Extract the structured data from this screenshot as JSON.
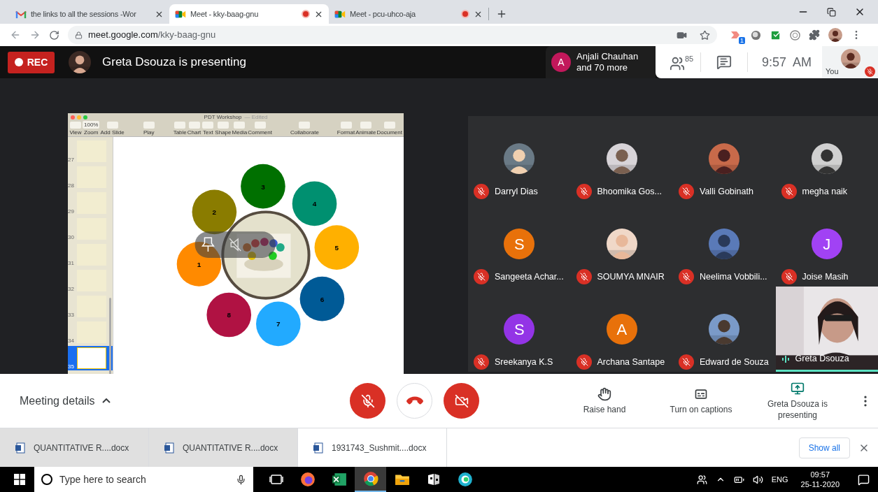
{
  "browser": {
    "tabs": [
      {
        "title": "the links to all the sessions -Wor",
        "kind": "mail",
        "selected": false,
        "recording": false
      },
      {
        "title": "Meet - kky-baag-gnu",
        "kind": "meet",
        "selected": true,
        "recording": true
      },
      {
        "title": "Meet - pcu-uhco-aja",
        "kind": "meet",
        "selected": false,
        "recording": true
      }
    ],
    "url_host": "meet.google.com",
    "url_path": "/kky-baag-gnu",
    "extension_badge": "1"
  },
  "meet": {
    "rec_label": "REC",
    "presenter_text": "Greta Dsouza is presenting",
    "notice": {
      "initial": "A",
      "name": "Anjali Chauhan",
      "more": "and 70 more"
    },
    "people_count": "85",
    "time": "9:57  AM",
    "self_label": "You",
    "self_muted": true
  },
  "presentation": {
    "app_title": "PDT Workshop",
    "app_status": "— Edited",
    "zoom": "100%",
    "toolbar_groups": [
      [
        {
          "label": "View"
        },
        {
          "label": "Zoom"
        },
        {
          "label": "Add Slide"
        }
      ],
      [
        {
          "label": "Play"
        }
      ],
      [
        {
          "label": "Table"
        },
        {
          "label": "Chart"
        },
        {
          "label": "Text"
        },
        {
          "label": "Shape"
        },
        {
          "label": "Media"
        },
        {
          "label": "Comment"
        }
      ],
      [
        {
          "label": "Collaborate"
        }
      ],
      [
        {
          "label": "Format"
        },
        {
          "label": "Animate"
        },
        {
          "label": "Document"
        }
      ]
    ],
    "slides": [
      {
        "number": "27",
        "selected": false
      },
      {
        "number": "28",
        "selected": false
      },
      {
        "number": "29",
        "selected": false
      },
      {
        "number": "30",
        "selected": false
      },
      {
        "number": "31",
        "selected": false
      },
      {
        "number": "32",
        "selected": false
      },
      {
        "number": "33",
        "selected": false
      },
      {
        "number": "34",
        "selected": false
      },
      {
        "number": "35",
        "selected": true
      }
    ],
    "circles": [
      {
        "label": "1",
        "color": "#ff8a00"
      },
      {
        "label": "2",
        "color": "#8a7c00"
      },
      {
        "label": "3",
        "color": "#007000"
      },
      {
        "label": "4",
        "color": "#009070"
      },
      {
        "label": "5",
        "color": "#ffb000"
      },
      {
        "label": "6",
        "color": "#005a96"
      },
      {
        "label": "7",
        "color": "#22aaff"
      },
      {
        "label": "8",
        "color": "#b01243"
      }
    ]
  },
  "participants": [
    {
      "name": "Darryl Dias",
      "muted": true
    },
    {
      "name": "Bhoomika Gos...",
      "muted": true
    },
    {
      "name": "Valli Gobinath",
      "muted": true
    },
    {
      "name": "megha naik",
      "muted": true
    },
    {
      "name": "Sangeeta Achar...",
      "kind": "letter",
      "initial": "S",
      "color": "#e8710a",
      "muted": true
    },
    {
      "name": "SOUMYA MNAIR",
      "muted": true
    },
    {
      "name": "Neelima Vobbili...",
      "muted": true
    },
    {
      "name": "Joise Masih",
      "kind": "letter",
      "initial": "J",
      "color": "#a142f4",
      "muted": true
    },
    {
      "name": "Sreekanya K.S",
      "kind": "letter",
      "initial": "S",
      "color": "#9334e6",
      "muted": true
    },
    {
      "name": "Archana Santape",
      "kind": "letter",
      "initial": "A",
      "color": "#e8710a",
      "muted": true
    },
    {
      "name": "Edward de Souza",
      "muted": true
    },
    {
      "name": "Greta Dsouza",
      "kind": "video",
      "muted": false
    }
  ],
  "controls": {
    "meeting_details": "Meeting details",
    "mic_muted": true,
    "camera_off": true,
    "actions": [
      {
        "kind": "hand",
        "label": "Raise hand"
      },
      {
        "kind": "captions",
        "label": "Turn on captions"
      },
      {
        "kind": "present",
        "label": "Greta Dsouza is presenting"
      }
    ]
  },
  "downloads": {
    "items": [
      {
        "name": "QUANTITATIVE R....docx",
        "highlighted": true
      },
      {
        "name": "QUANTITATIVE R....docx",
        "highlighted": true
      },
      {
        "name": "1931743_Sushmit....docx",
        "highlighted": false
      }
    ],
    "show_all": "Show all"
  },
  "taskbar": {
    "search_placeholder": "Type here to search",
    "apps": [
      {
        "kind": "taskview",
        "active": false
      },
      {
        "kind": "firefox",
        "active": false
      },
      {
        "kind": "excel",
        "active": false
      },
      {
        "kind": "chrome",
        "active": true
      },
      {
        "kind": "files",
        "active": false
      },
      {
        "kind": "store",
        "active": false
      },
      {
        "kind": "edge",
        "active": false
      }
    ],
    "language": "ENG",
    "time": "09:57",
    "date": "25-11-2020"
  }
}
